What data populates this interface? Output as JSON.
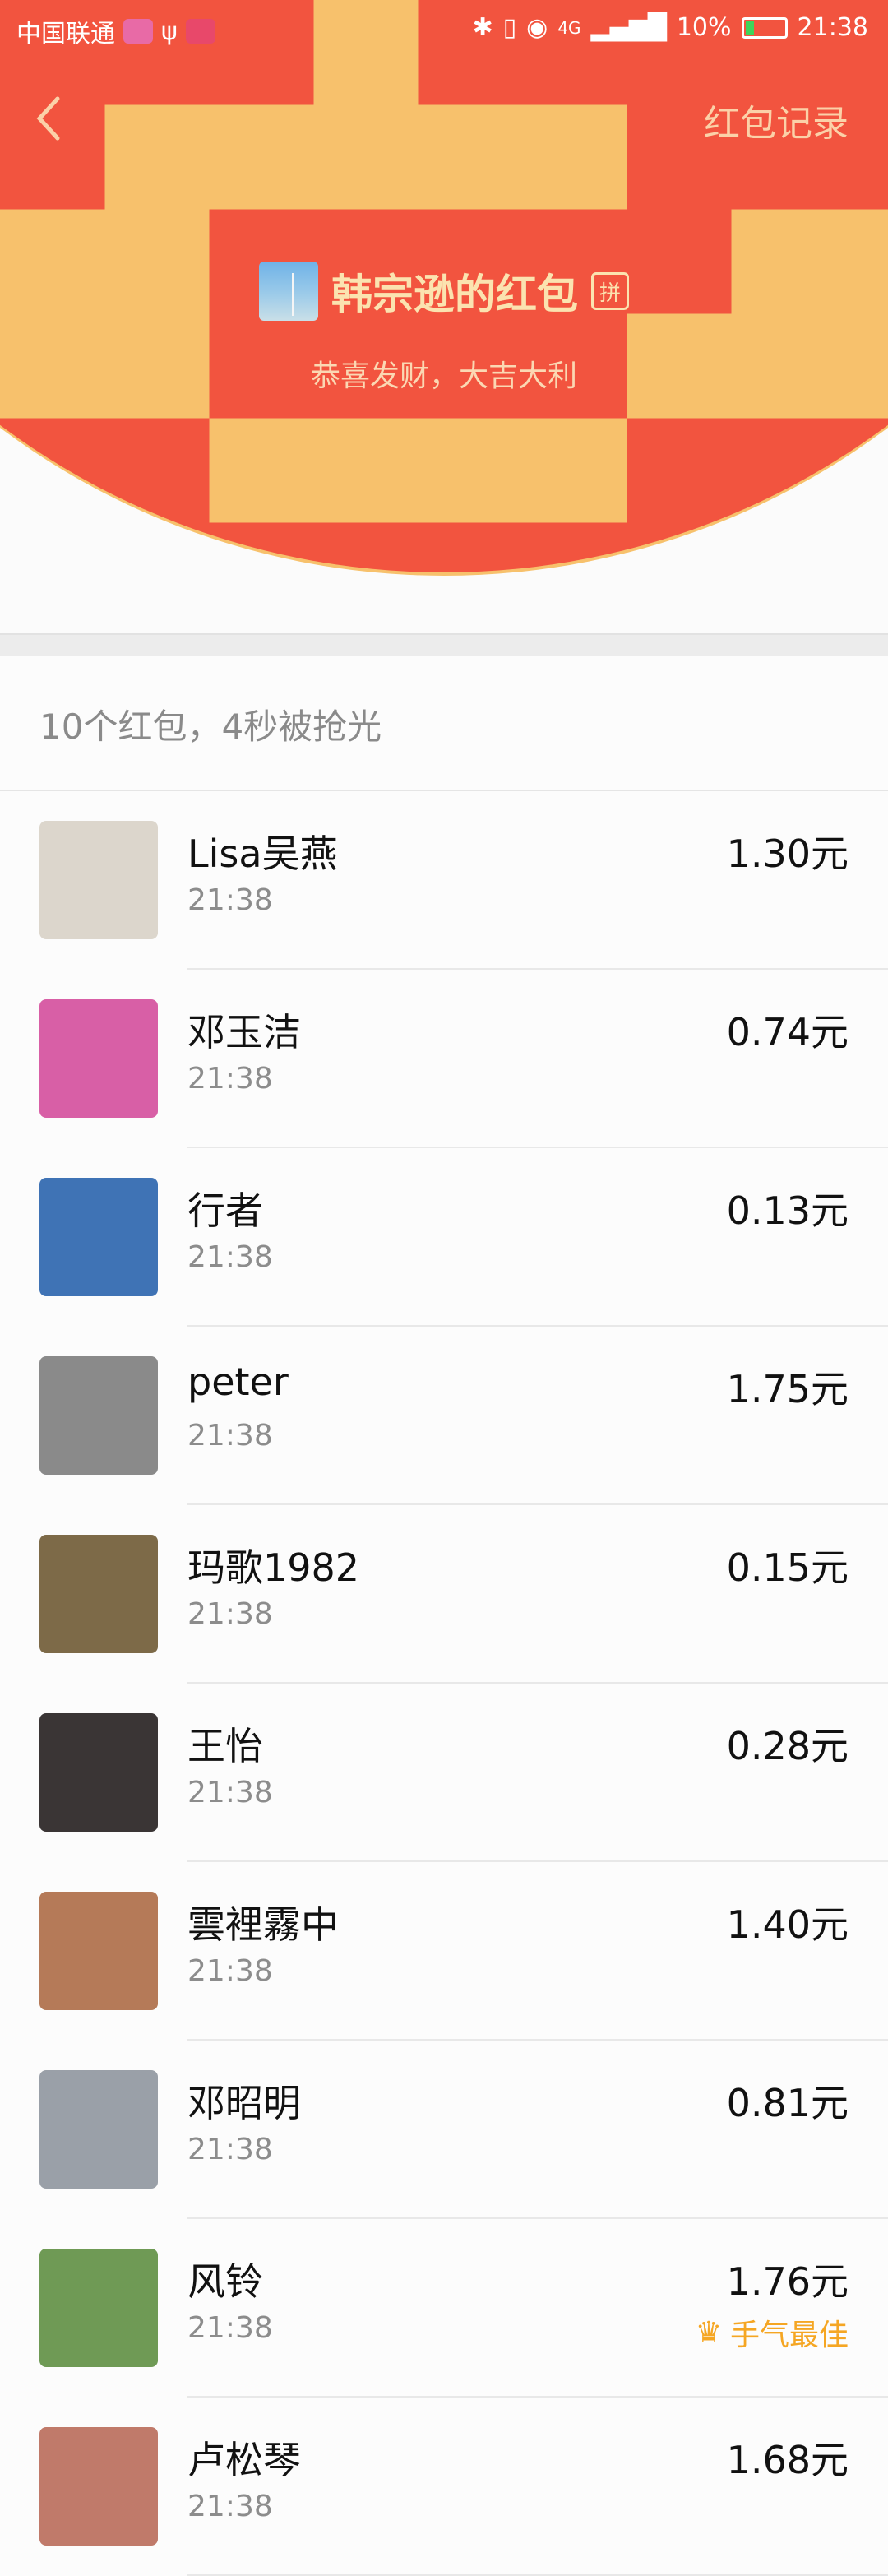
{
  "status_bar": {
    "carrier": "中国联通",
    "network": "4G",
    "battery": "10%",
    "time": "21:38"
  },
  "header": {
    "record_link": "红包记录",
    "sender_title": "韩宗逊的红包",
    "pin_badge": "拼",
    "greeting": "恭喜发财，大吉大利"
  },
  "summary": "10个红包，4秒被抢光",
  "records": [
    {
      "name": "Lisa吴燕",
      "time": "21:38",
      "amount": "1.30元",
      "avatar_color": "#dcd6cc"
    },
    {
      "name": "邓玉洁",
      "time": "21:38",
      "amount": "0.74元",
      "avatar_color": "#d85fa6"
    },
    {
      "name": "行者",
      "time": "21:38",
      "amount": "0.13元",
      "avatar_color": "#3f73b5"
    },
    {
      "name": "peter",
      "time": "21:38",
      "amount": "1.75元",
      "avatar_color": "#8a8a8a"
    },
    {
      "name": "玛歌1982",
      "time": "21:38",
      "amount": "0.15元",
      "avatar_color": "#7d6a48"
    },
    {
      "name": "王怡",
      "time": "21:38",
      "amount": "0.28元",
      "avatar_color": "#3a3535"
    },
    {
      "name": "雲裡霧中",
      "time": "21:38",
      "amount": "1.40元",
      "avatar_color": "#b57a58"
    },
    {
      "name": "邓昭明",
      "time": "21:38",
      "amount": "0.81元",
      "avatar_color": "#9aa0a8"
    },
    {
      "name": "风铃",
      "time": "21:38",
      "amount": "1.76元",
      "avatar_color": "#6f9a55",
      "best_label": "手气最佳"
    },
    {
      "name": "卢松琴",
      "time": "21:38",
      "amount": "1.68元",
      "avatar_color": "#c07a6a"
    }
  ],
  "colors": {
    "header_red": "#f2543f",
    "title_gold": "#fbe3b0",
    "best_orange": "#f5a623"
  },
  "icons": {
    "back": "chevron-left-icon",
    "crown": "crown-icon"
  }
}
